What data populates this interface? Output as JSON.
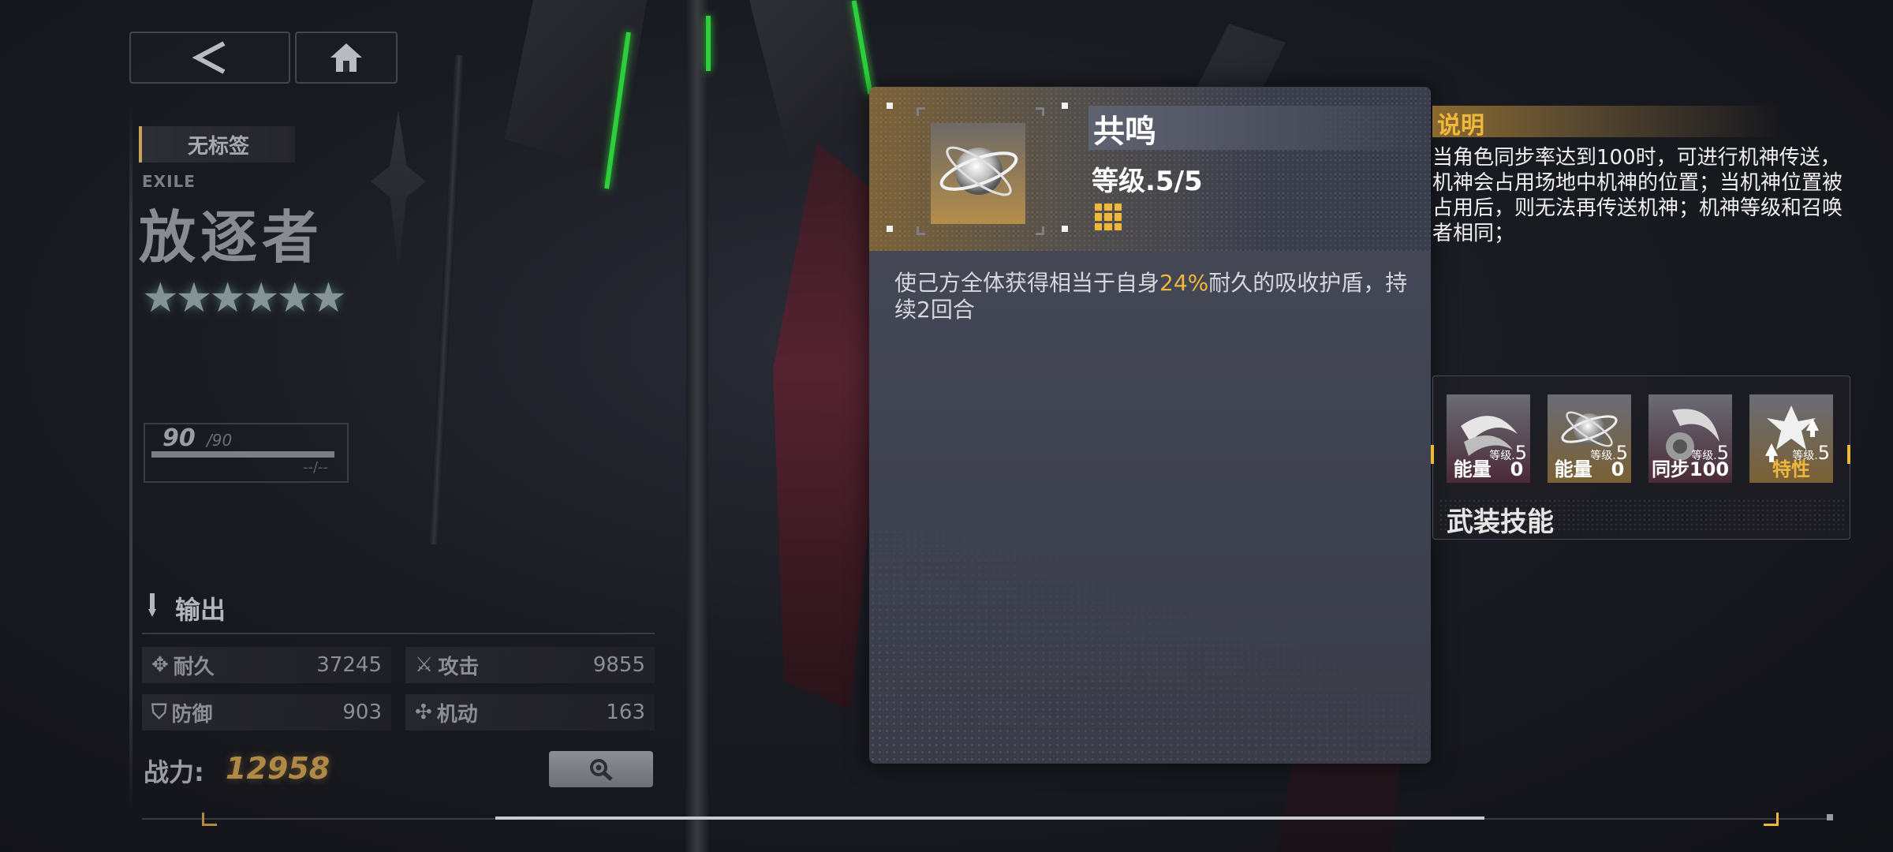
{
  "nav": {
    "back_icon": "back-arrow-icon",
    "home_icon": "home-icon"
  },
  "unit": {
    "tag": "无标签",
    "name_en": "EXILE",
    "name": "放逐者",
    "stars": "★★★★★★",
    "level": "90",
    "level_max": "/90",
    "level_sub": "--/--",
    "role": "输出",
    "stats": [
      {
        "label": "耐久",
        "value": "37245",
        "icon": "durability-icon"
      },
      {
        "label": "攻击",
        "value": "9855",
        "icon": "attack-icon"
      },
      {
        "label": "防御",
        "value": "903",
        "icon": "defense-icon"
      },
      {
        "label": "机动",
        "value": "163",
        "icon": "mobility-icon"
      }
    ],
    "power_label": "战力:",
    "power_value": "12958"
  },
  "popup": {
    "skill_name": "共鸣",
    "skill_level": "等级.5/5",
    "desc_before": "使己方全体获得相当于自身",
    "desc_highlight": "24%",
    "desc_after": "耐久的吸收护盾，持续2回合"
  },
  "explain": {
    "title": "说明",
    "text": "当角色同步率达到100时，可进行机神传送，机神会占用场地中机神的位置；当机神位置被占用后，则无法再传送机神；机神等级和召唤者相同；"
  },
  "armed_skills": {
    "title": "武装技能",
    "level_prefix": "等级.",
    "items": [
      {
        "level": "5",
        "label": "能量　0",
        "icon": "slash-skill-icon"
      },
      {
        "level": "5",
        "label": "能量　0",
        "icon": "resonance-skill-icon"
      },
      {
        "level": "5",
        "label": "同步100",
        "icon": "mech-skill-icon"
      },
      {
        "level": "5",
        "label": "特性",
        "icon": "trait-skill-icon"
      }
    ]
  },
  "colors": {
    "accent": "#f0b83a",
    "power": "#b08a45",
    "green_glow": "#2ccf39"
  }
}
